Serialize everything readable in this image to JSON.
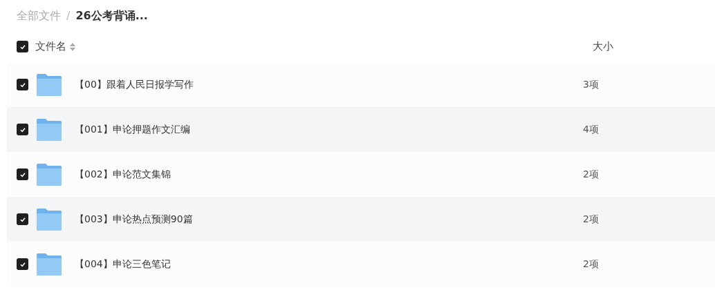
{
  "breadcrumb": [
    {
      "label": "全部文件",
      "current": false
    },
    {
      "label": "26公考背诵...",
      "current": true
    }
  ],
  "breadcrumb_separator": "/",
  "table": {
    "select_all": {
      "checked": true
    },
    "columns": [
      "文件名",
      "大小"
    ],
    "rows": [
      {
        "name": "【00】跟着人民日报学写作",
        "size": "3项",
        "checked": true
      },
      {
        "name": "【001】申论押题作文汇编",
        "size": "4项",
        "checked": true
      },
      {
        "name": "【002】申论范文集锦",
        "size": "2项",
        "checked": true
      },
      {
        "name": "【003】申论热点预测90篇",
        "size": "2项",
        "checked": true
      },
      {
        "name": "【004】申论三色笔记",
        "size": "2项",
        "checked": true
      }
    ]
  }
}
